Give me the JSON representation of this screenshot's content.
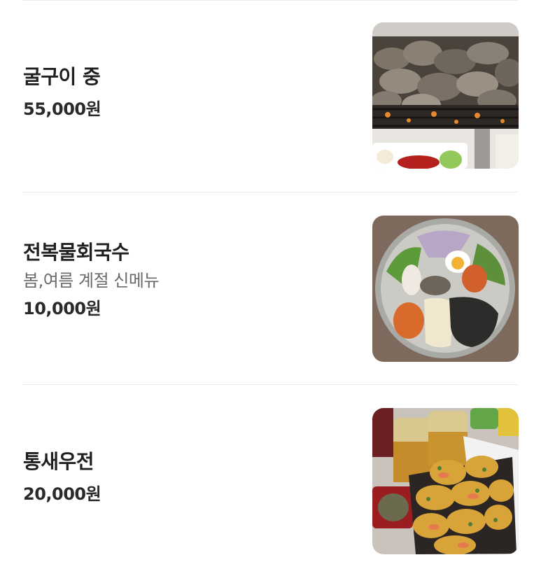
{
  "menu": {
    "items": [
      {
        "name": "굴구이 중",
        "description": "",
        "price": "55,000원",
        "image": "grilled-oysters-photo"
      },
      {
        "name": "전복물회국수",
        "description": "봄,여름 계절 신메뉴",
        "price": "10,000원",
        "image": "abalone-cold-noodle-photo"
      },
      {
        "name": "통새우전",
        "description": "",
        "price": "20,000원",
        "image": "whole-shrimp-pancake-photo"
      }
    ]
  }
}
